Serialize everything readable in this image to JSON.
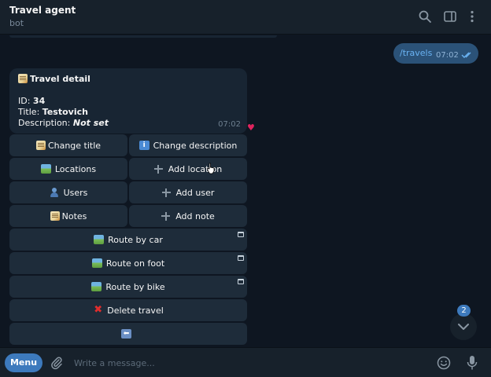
{
  "header": {
    "title": "Travel agent",
    "subtitle": "bot"
  },
  "messages": {
    "outgoing": {
      "text": "/travels",
      "time": "07:02"
    },
    "incoming": {
      "heading": "Travel detail",
      "id_label": "ID:",
      "id_value": "34",
      "title_label": "Title:",
      "title_value": "Testovich",
      "description_label": "Description:",
      "description_value": "Not set",
      "time": "07:02",
      "reaction": "♥"
    }
  },
  "keyboard": {
    "change_title": "Change title",
    "change_description": "Change description",
    "locations": "Locations",
    "add_location": "Add location",
    "users": "Users",
    "add_user": "Add user",
    "notes": "Notes",
    "add_note": "Add note",
    "route_by_car": "Route by car",
    "route_on_foot": "Route on foot",
    "route_by_bike": "Route by bike",
    "delete_travel": "Delete travel",
    "back_glyph": "⬅"
  },
  "scroll": {
    "unread_count": "2"
  },
  "composer": {
    "menu_label": "Menu",
    "placeholder": "Write a message..."
  },
  "colors": {
    "background": "#0e1621",
    "panel": "#17212b",
    "incoming_bubble": "#182533",
    "outgoing_bubble": "#2b5278",
    "keyboard_button": "#1e2c3a",
    "accent": "#3d7abd"
  },
  "icons": [
    "search-icon",
    "sidebar-toggle-icon",
    "more-vertical-icon",
    "double-check-icon",
    "memo-icon",
    "map-icon",
    "info-icon",
    "user-icon",
    "plus-icon",
    "cross-mark-icon",
    "back-arrow-icon",
    "web-app-icon",
    "chevron-down-icon",
    "paperclip-icon",
    "emoji-icon",
    "microphone-icon"
  ]
}
